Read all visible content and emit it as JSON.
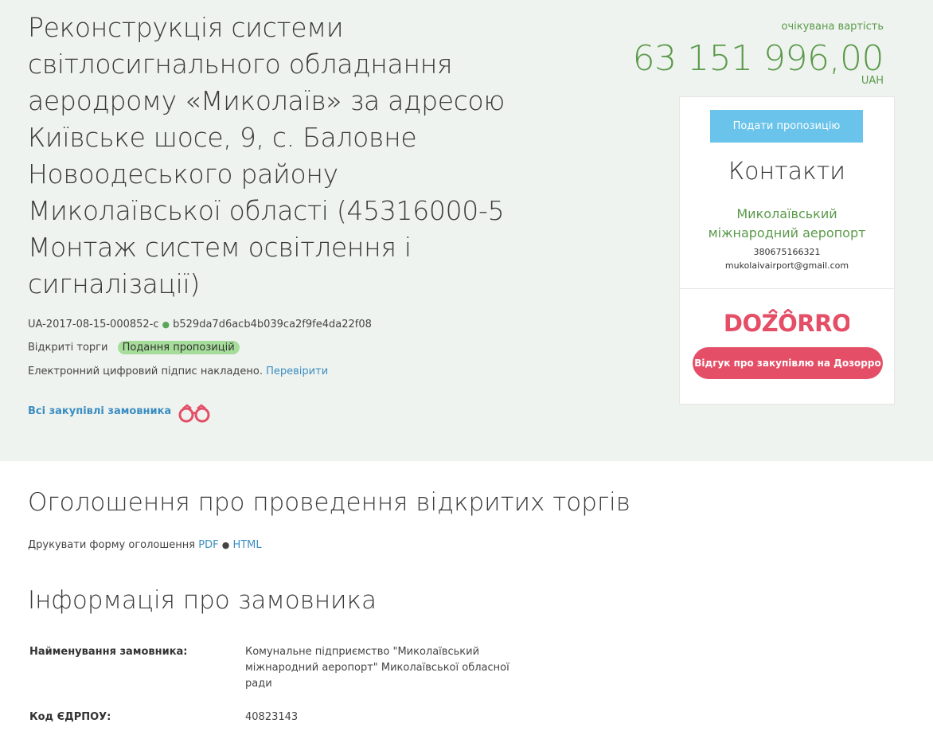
{
  "tender": {
    "title": "Реконструкція системи світлосигнального обладнання аеродрому «Миколаїв» за адресою Київське шосе, 9, с. Баловне Новоодеського району Миколаївської області (45316000-5 Монтаж систем освітлення і сигналізації)",
    "id": "UA-2017-08-15-000852-c",
    "hash": "b529da7d6acb4b039ca2f9fe4da22f08",
    "procedure": "Відкриті торги",
    "status_badge": "Подання пропозицій",
    "signature_text": "Електронний цифровий підпис накладено.",
    "verify_link": "Перевірити",
    "all_purchases_link": "Всі закупівлі замовника"
  },
  "price": {
    "label": "очікувана вартість",
    "value": "63 151 996,00",
    "currency": "UAH"
  },
  "card": {
    "submit_label": "Подати пропозицію",
    "contacts_heading": "Контакти",
    "org_name": "Миколаївський міжнародний аеропорт",
    "phone": "380675166321",
    "email": "mukolaivairport@gmail.com",
    "dozorro_logo_text": "DOZORRO",
    "dozorro_button": "Відгук про закупівлю на Дозорро"
  },
  "announcement": {
    "title": "Оголошення про проведення відкритих торгів",
    "print_label": "Друкувати форму оголошення",
    "pdf_link": "PDF",
    "separator": "●",
    "html_link": "HTML"
  },
  "customer": {
    "title": "Інформація про замовника",
    "rows": [
      {
        "label": "Найменування замовника:",
        "value": "Комунальне підприємство \"Миколаївський міжнародний аеропорт\" Миколаївської обласної ради"
      },
      {
        "label": "Код ЄДРПОУ:",
        "value": "40823143"
      }
    ]
  },
  "colors": {
    "accent_green": "#5a9a4a",
    "link_blue": "#3b8ec2",
    "button_blue": "#69c3ea",
    "dozorro_red": "#e44f67",
    "badge_green": "#a7dd9a",
    "hero_bg": "#eff3ef"
  }
}
